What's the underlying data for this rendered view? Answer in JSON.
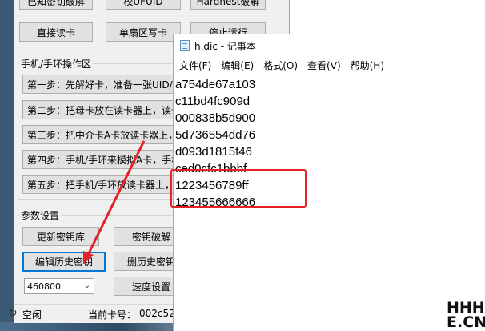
{
  "tool_window": {
    "top_buttons": [
      "已知密钥破解",
      "校UFUID",
      "Hardnest破解"
    ],
    "row2_buttons": [
      "直接读卡",
      "单扇区写卡",
      "停止运行"
    ],
    "phone_group": {
      "title": "手机/手环操作区",
      "steps": [
        "第一步：先解好卡，准备一张UID/C",
        "第二步：把母卡放在读卡器上，读卡",
        "第三步：把中介卡A卡放读卡器上，",
        "第四步：手机/手环来模拟A卡，手机",
        "第五步：把手机/手环放读卡器上，"
      ]
    },
    "params_group": {
      "title": "参数设置",
      "buttons": [
        "更新密钥库",
        "密钥破解",
        "编辑历史密钥",
        "删历史密钥"
      ],
      "baud_select": "460800",
      "speed_button": "速度设置"
    },
    "status": {
      "state": "空闲",
      "card_label": "当前卡号：",
      "card_value": "002c52"
    }
  },
  "notepad": {
    "title": "h.dic - 记事本",
    "menu": [
      "文件(F)",
      "编辑(E)",
      "格式(O)",
      "查看(V)",
      "帮助(H)"
    ],
    "lines": [
      "a754de67a103",
      "c11bd4fc909d",
      "000838b5d900",
      "5d736554dd76",
      "d093d1815f46",
      "ced0cfc1bbbf",
      "1223456789ff",
      "123455666666"
    ]
  },
  "annotation": {
    "color": "#e52229"
  },
  "watermark": {
    "line1": "HHH",
    "line2": "E.CN"
  }
}
